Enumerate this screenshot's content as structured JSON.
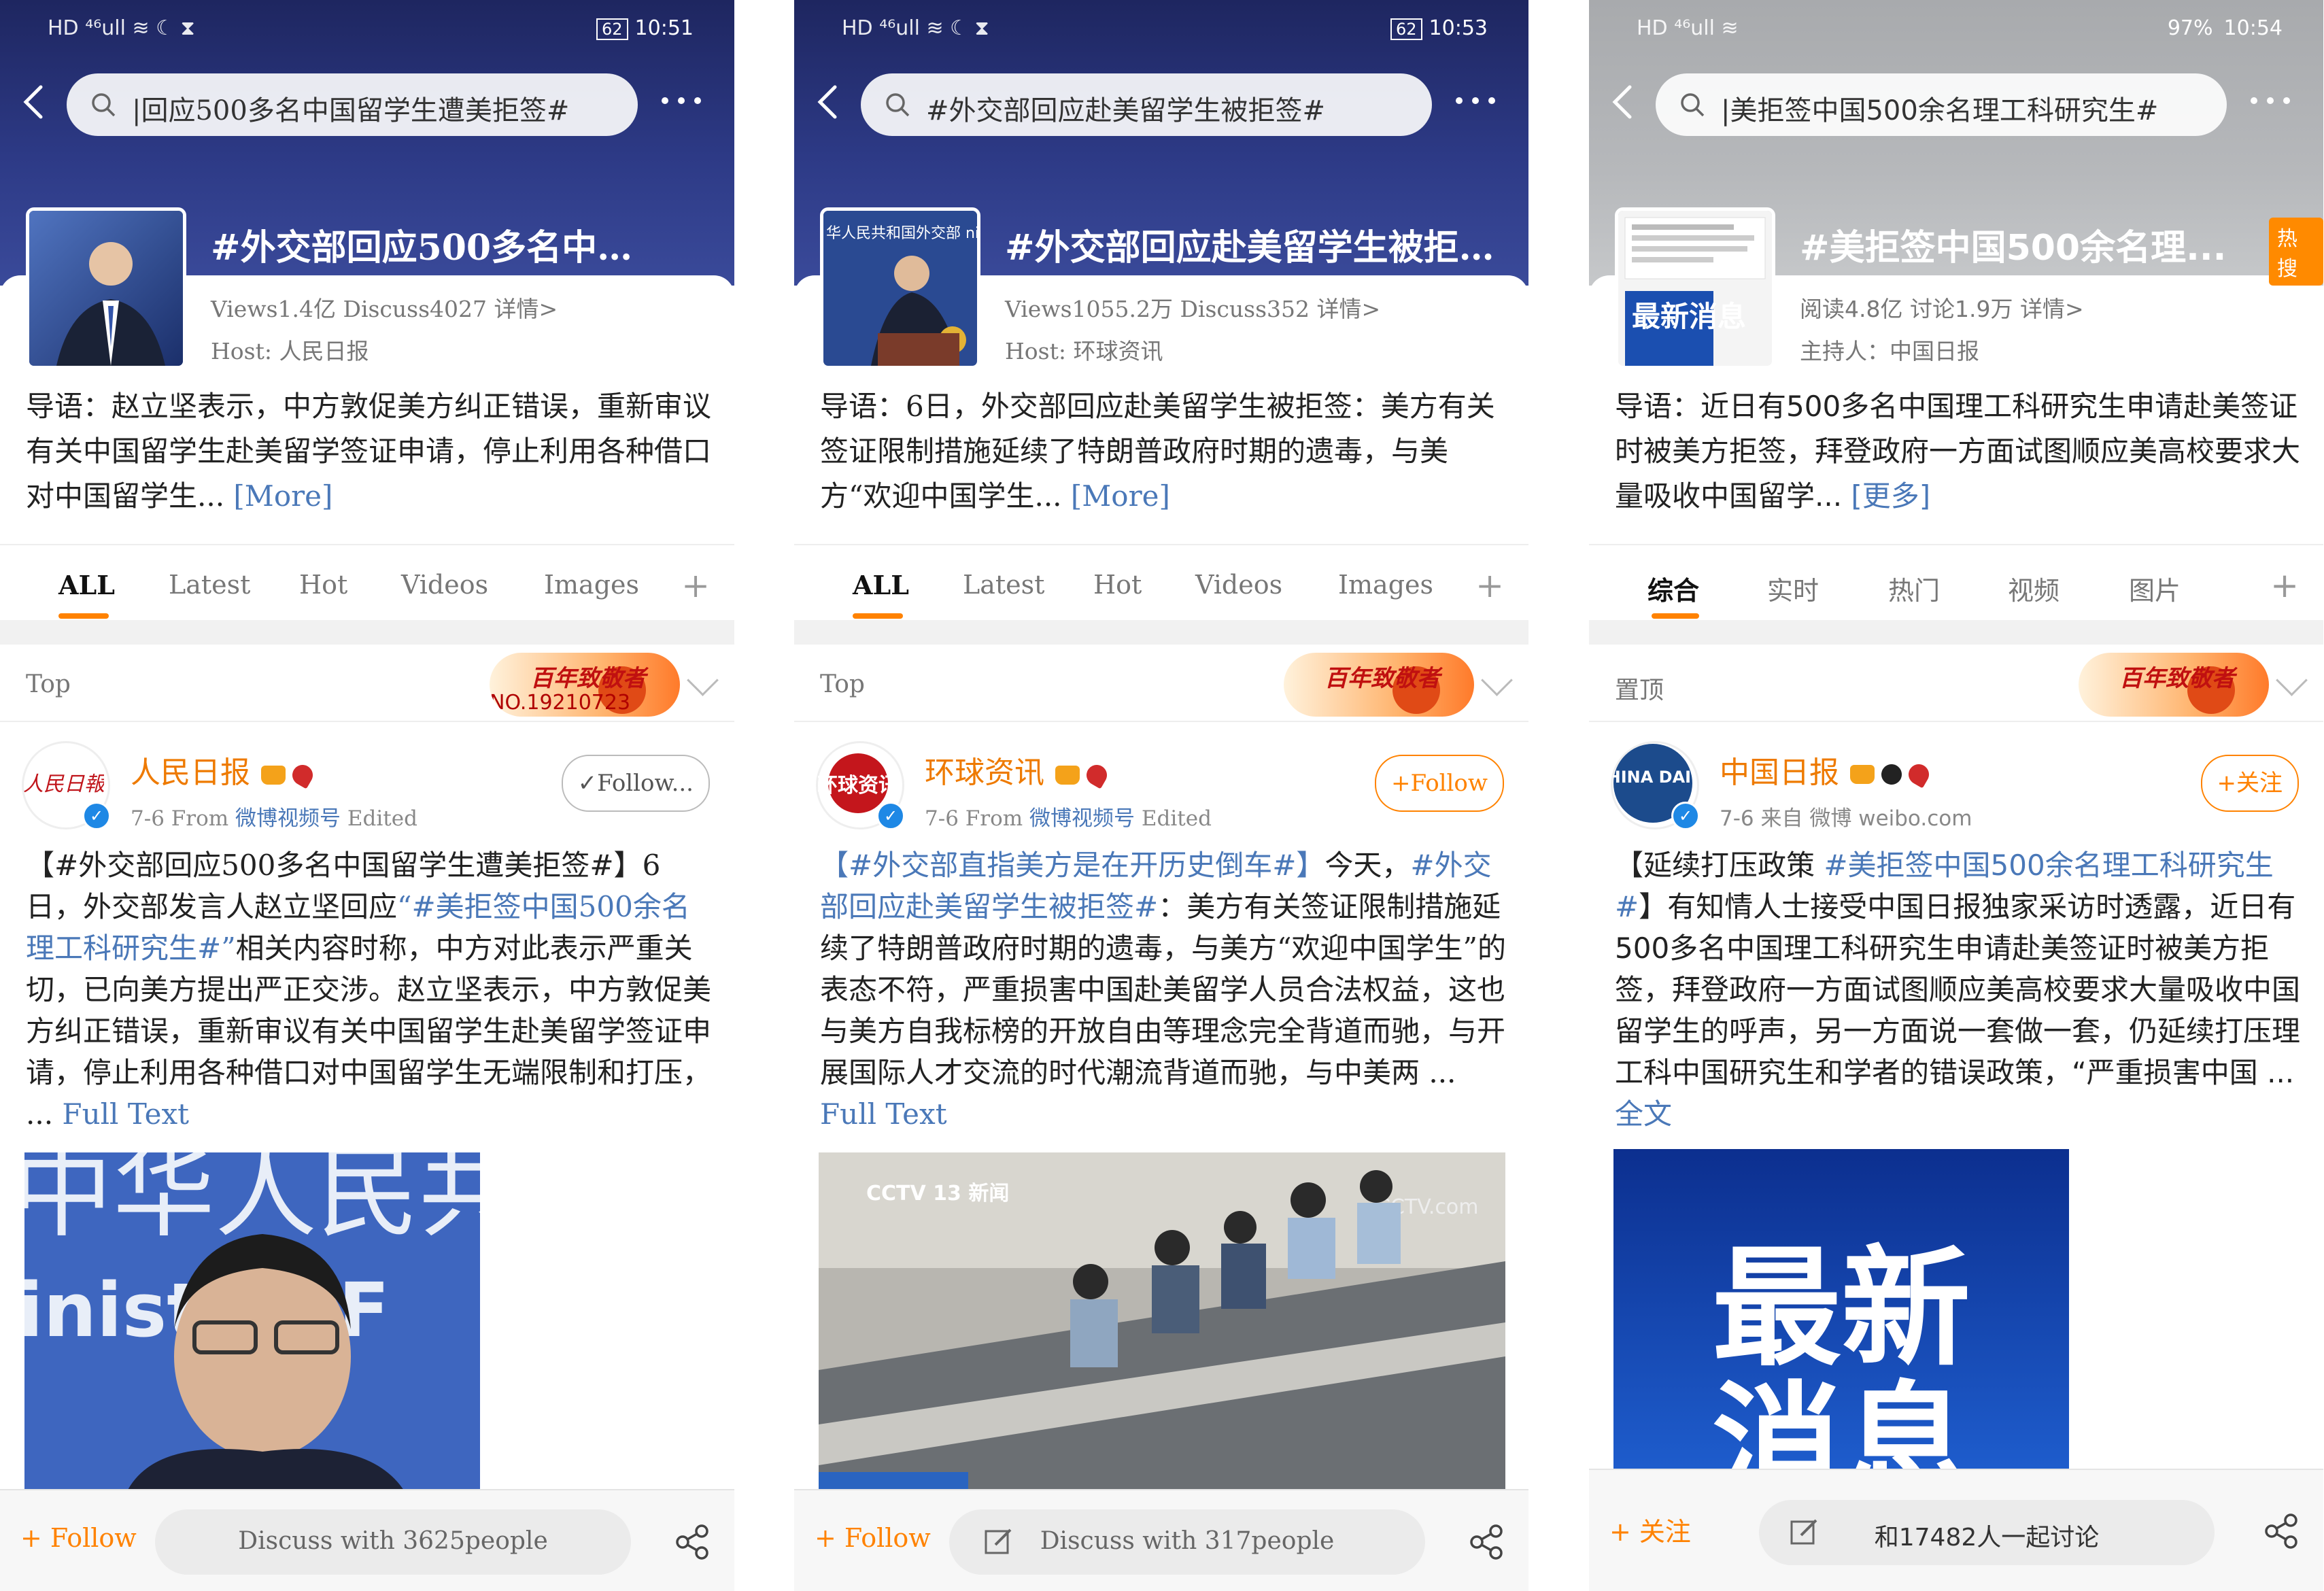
{
  "panels": [
    {
      "status": {
        "left": "HD ⁴⁶ull ≋ ☾ ⧗",
        "battery": "62",
        "time": "10:51"
      },
      "search": "|回应500多名中国留学生遭美拒签#",
      "topic": {
        "title": "#外交部回应500多名中…",
        "stats": "Views1.4亿  Discuss4027  详情>",
        "host": "Host: 人民日报",
        "intro": "导语：赵立坚表示，中方敦促美方纠正错误，重新审议有关中国留学生赴美留学签证申请，停止利用各种借口对中国留学生...",
        "intro_more": "[More]"
      },
      "tabs": [
        "ALL",
        "Latest",
        "Hot",
        "Videos",
        "Images"
      ],
      "top_label": "Top",
      "medal": {
        "text": "百年致敬者",
        "number": "NO.19210723"
      },
      "post": {
        "author": "人民日报",
        "date": "7-6",
        "from_label": "From",
        "source": "微博视频号",
        "edited": "Edited",
        "follow": "✓Follow...",
        "tag1": "【#外交部回应500多名中国留学生遭美拒签#】",
        "text1": "6日，外交部发言人赵立坚回应",
        "tag2": "“#美拒签中国500余名理工科研究生#”",
        "text2": "相关内容时称，中方对此表示严重关切，已向美方提出严正交涉。赵立坚表示，中方敦促美方纠正错误，重新审议有关中国留学生赴美留学签证申请，停止利用各种借口对中国留学生无端限制和打压， ...",
        "full": "Full Text",
        "image_text": "中华人民共",
        "image_text2": "inist of F"
      },
      "bottom": {
        "follow": "+ Follow",
        "discuss": "Discuss with 3625people"
      }
    },
    {
      "status": {
        "left": "HD ⁴⁶ull ≋ ☾ ⧗",
        "battery": "62",
        "time": "10:53"
      },
      "search": "#外交部回应赴美留学生被拒签#",
      "topic": {
        "title": "#外交部回应赴美留学生被拒…",
        "stats": "Views1055.2万  Discuss352  详情>",
        "host": "Host: 环球资讯",
        "intro": "导语：6日，外交部回应赴美留学生被拒签：美方有关签证限制措施延续了特朗普政府时期的遗毒，与美方“欢迎中国学生...",
        "intro_more": "[More]",
        "image_text": "华人民共和国外交部 nistry of Foreign Affairs"
      },
      "tabs": [
        "ALL",
        "Latest",
        "Hot",
        "Videos",
        "Images"
      ],
      "top_label": "Top",
      "medal": {
        "text": "百年致敬者",
        "number": ""
      },
      "post": {
        "author": "环球资讯",
        "date": "7-6",
        "from_label": "From",
        "source": "微博视频号",
        "edited": "Edited",
        "follow": "+Follow",
        "avatar_text": "环球资讯",
        "tag1": "【#外交部直指美方是在开历史倒车#】",
        "text1": "今天，",
        "tag2": "#外交部回应赴美留学生被拒签#",
        "text2": "：美方有关签证限制措施延续了特朗普政府时期的遗毒，与美方“欢迎中国学生”的表态不符，严重损害中国赴美留学人员合法权益，这也与美方自我标榜的开放自由等理念完全背道而驰，与开展国际人才交流的时代潮流背道而驰，与中美两 ...",
        "full": "Full Text",
        "image_text": "CCTV 13 新闻",
        "image_text2": "CCTV.com"
      },
      "bottom": {
        "follow": "+ Follow",
        "discuss": "Discuss with 317people"
      }
    },
    {
      "status": {
        "left": "HD ⁴⁶ull ≋",
        "battery": "97%",
        "time": "10:54"
      },
      "search": "|美拒签中国500余名理工科研究生#",
      "topic": {
        "title": "#美拒签中国500余名理...",
        "hot": "热搜",
        "stats": "阅读4.8亿  讨论1.9万  详情>",
        "host": "主持人：中国日报",
        "intro": "导语：近日有500多名中国理工科研究生申请赴美签证时被美方拒签，拜登政府一方面试图顺应美高校要求大量吸收中国留学...",
        "intro_more": "[更多]",
        "image_text": "最新消息"
      },
      "tabs": [
        "综合",
        "实时",
        "热门",
        "视频",
        "图片"
      ],
      "top_label": "置顶",
      "medal": {
        "text": "百年致敬者",
        "number": ""
      },
      "post": {
        "author": "中国日报",
        "date": "7-6",
        "from_label": "来自",
        "source": "微博 weibo.com",
        "edited": "",
        "follow": "+关注",
        "avatar_text": "CHINA DAILY",
        "tag1": "【延续打压政策 ",
        "text1": "",
        "tag2": "#美拒签中国500余名理工科研究生#",
        "text2": "】有知情人士接受中国日报独家采访时透露，近日有500多名中国理工科研究生申请赴美签证时被美方拒签，拜登政府一方面试图顺应美高校要求大量吸收中国留学生的呼声，另一方面说一套做一套，仍延续打压理工科中国研究生和学者的错误政策，“严重损害中国 ...",
        "full": "全文",
        "image_text": "最新",
        "image_text2": "消息"
      },
      "bottom": {
        "follow": "+ 关注",
        "discuss": "和17482人一起讨论"
      }
    }
  ],
  "colors": {
    "accent": "#ff8200",
    "link": "#4a78b8",
    "username": "#ee7a00"
  }
}
